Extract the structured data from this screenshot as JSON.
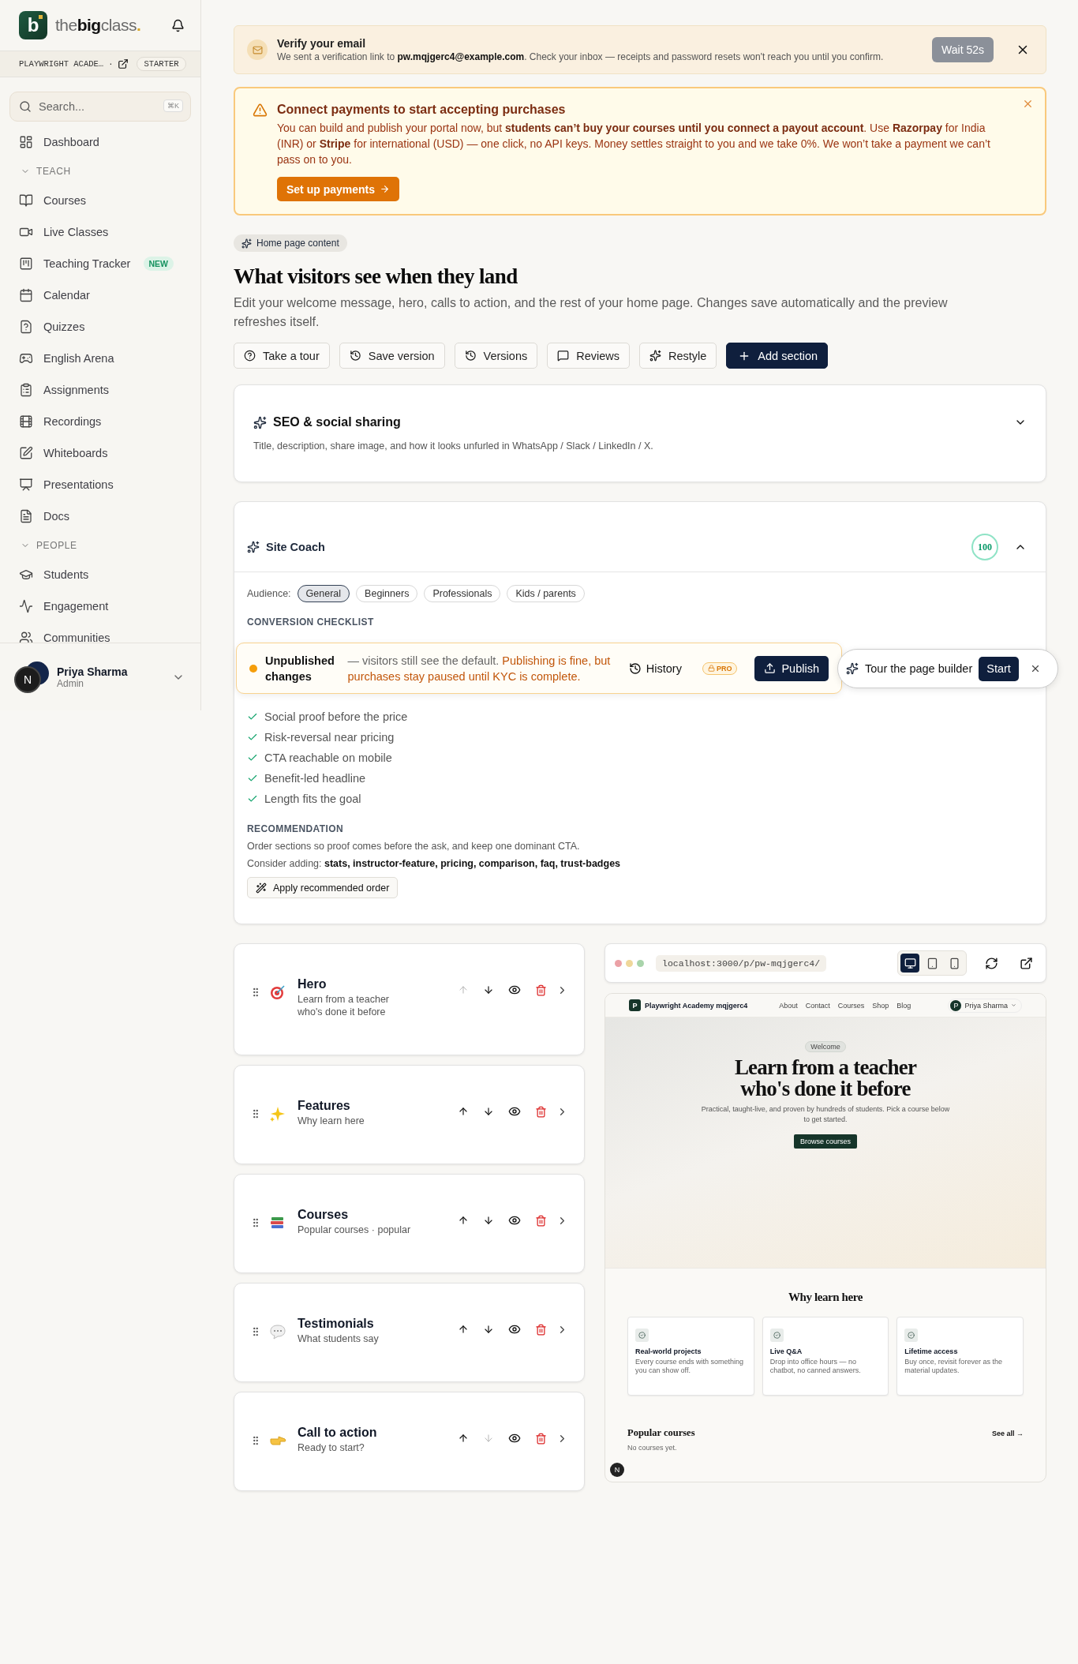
{
  "sidebar": {
    "logo_mark": "b",
    "wordmark": "the**big**class",
    "wordmark_dot": ".",
    "workspace": "PLAYWRIGHT ACADE…",
    "separator": "·",
    "plan": "STARTER",
    "search": {
      "placeholder": "Search...",
      "shortcut": "⌘K"
    },
    "nav": [
      {
        "kind": "item",
        "label": "Dashboard",
        "selected": false
      },
      {
        "kind": "group",
        "label": "TEACH",
        "expanded": true,
        "children": [
          {
            "label": "Courses",
            "selected": false
          },
          {
            "label": "Live Classes",
            "selected": false
          },
          {
            "label": "Teaching Tracker",
            "selected": false,
            "badge": "NEW"
          },
          {
            "label": "Calendar",
            "selected": false
          },
          {
            "label": "Quizzes",
            "selected": false
          },
          {
            "label": "English Arena",
            "selected": false
          },
          {
            "label": "Assignments",
            "selected": false
          },
          {
            "label": "Recordings",
            "selected": false
          },
          {
            "label": "Whiteboards",
            "selected": false
          },
          {
            "label": "Presentations",
            "selected": false
          },
          {
            "label": "Docs",
            "selected": false
          }
        ]
      },
      {
        "kind": "group",
        "label": "PEOPLE",
        "expanded": true,
        "children": [
          {
            "label": "Students",
            "selected": false
          },
          {
            "label": "Engagement",
            "selected": false
          },
          {
            "label": "Communities",
            "selected": false
          }
        ]
      }
    ],
    "user": {
      "initial": "N",
      "name": "Priya Sharma",
      "role": "Admin"
    }
  },
  "verify_banner": {
    "title": "Verify your email",
    "text": "We sent a verification link to **pw.mqjgerc4@example.com**. Check your inbox — receipts and password resets won't reach you until you confirm.",
    "button": "Wait 52s",
    "button_disabled": true
  },
  "payment_banner": {
    "title": "Connect payments to start accepting purchases",
    "text": "You can build and publish your portal now, but **students can’t buy your courses until you connect a payout account**. Use **Razorpay** for India (INR) or **Stripe**  for international (USD) — one click, no API keys. Money settles straight to you and we take 0%. We won’t take a payment we can’t pass on to you.",
    "button": "Set up payments"
  },
  "chip": "Home page content",
  "heading": "What visitors see when they land",
  "description": "Edit your welcome message, hero, calls to action, and the rest of your home page. Changes save automatically and the preview refreshes itself.",
  "toolbar": [
    {
      "kind": "outline",
      "label": "Take a tour"
    },
    {
      "kind": "outline",
      "label": "Save version"
    },
    {
      "kind": "outline",
      "label": "Versions"
    },
    {
      "kind": "outline",
      "label": "Reviews"
    },
    {
      "kind": "outline",
      "label": "Restyle"
    },
    {
      "kind": "primary",
      "label": "Add section"
    }
  ],
  "seo": {
    "title": "SEO & social sharing",
    "description": "Title, description, share image, and how it looks unfurled in WhatsApp / Slack / LinkedIn / X.",
    "expanded": false
  },
  "coach": {
    "title": "Site Coach",
    "score": "100",
    "expanded": true,
    "audience_label": "Audience:",
    "audiences": [
      {
        "label": "General",
        "selected": true
      },
      {
        "label": "Beginners",
        "selected": false
      },
      {
        "label": "Professionals",
        "selected": false
      },
      {
        "label": "Kids / parents",
        "selected": false
      }
    ],
    "checklist_title": "CONVERSION CHECKLIST",
    "checklist": [
      {
        "label": "Social proof before the price",
        "done": true
      },
      {
        "label": "Risk-reversal near pricing",
        "done": true
      },
      {
        "label": "CTA reachable on mobile",
        "done": true
      },
      {
        "label": "Benefit-led headline",
        "done": true
      },
      {
        "label": "Length fits the goal",
        "done": true
      }
    ],
    "recommendation_title": "RECOMMENDATION",
    "recommendation": "Order sections so proof comes before the ask, and keep one dominant CTA.",
    "consider": "Consider adding: **stats, instructor-feature, pricing, comparison, faq, trust-badges**",
    "apply_button": "Apply recommended order"
  },
  "publish_bar": {
    "status": "Unpublished changes",
    "note": "— visitors still see the default.",
    "warning": "Publishing is fine, but purchases stay paused until KYC is complete.",
    "history": "History",
    "pro": "PRO",
    "publish": "Publish"
  },
  "tour": {
    "label": "Tour the page builder",
    "button": "Start"
  },
  "sections": [
    {
      "title": "Hero",
      "subtitle": "Learn from a teacher who's done it before",
      "can_move_up": false,
      "can_move_down": true
    },
    {
      "title": "Features",
      "subtitle": "Why learn here",
      "can_move_up": true,
      "can_move_down": true
    },
    {
      "title": "Courses",
      "subtitle": "Popular courses · popular",
      "can_move_up": true,
      "can_move_down": true
    },
    {
      "title": "Testimonials",
      "subtitle": "What students say",
      "can_move_up": true,
      "can_move_down": true
    },
    {
      "title": "Call to action",
      "subtitle": "Ready to start?",
      "can_move_up": true,
      "can_move_down": false
    }
  ],
  "preview": {
    "url": "localhost:3000/p/pw-mqjgerc4/",
    "devices": [
      {
        "selected": true
      },
      {
        "selected": false
      },
      {
        "selected": false
      }
    ],
    "site": {
      "logo": "P",
      "name": "Playwright Academy mqjgerc4",
      "nav": [
        "About",
        "Contact",
        "Courses",
        "Shop",
        "Blog"
      ],
      "user_initial": "P",
      "user_name": "Priya Sharma",
      "welcome": "Welcome",
      "headline": "Learn from a teacher who's done it before",
      "subtitle": "Practical, taught-live, and proven by hundreds of students. Pick a course below to get started.",
      "cta": "Browse courses",
      "features_title": "Why learn here",
      "features": [
        {
          "title": "Real-world projects",
          "text": "Every course ends with something you can show off."
        },
        {
          "title": "Live Q&A",
          "text": "Drop into office hours — no chatbot, no canned answers."
        },
        {
          "title": "Lifetime access",
          "text": "Buy once, revisit forever as the material updates."
        }
      ],
      "popular_title": "Popular courses",
      "see_all": "See all →",
      "empty": "No courses yet.",
      "floating_initial": "N"
    }
  }
}
